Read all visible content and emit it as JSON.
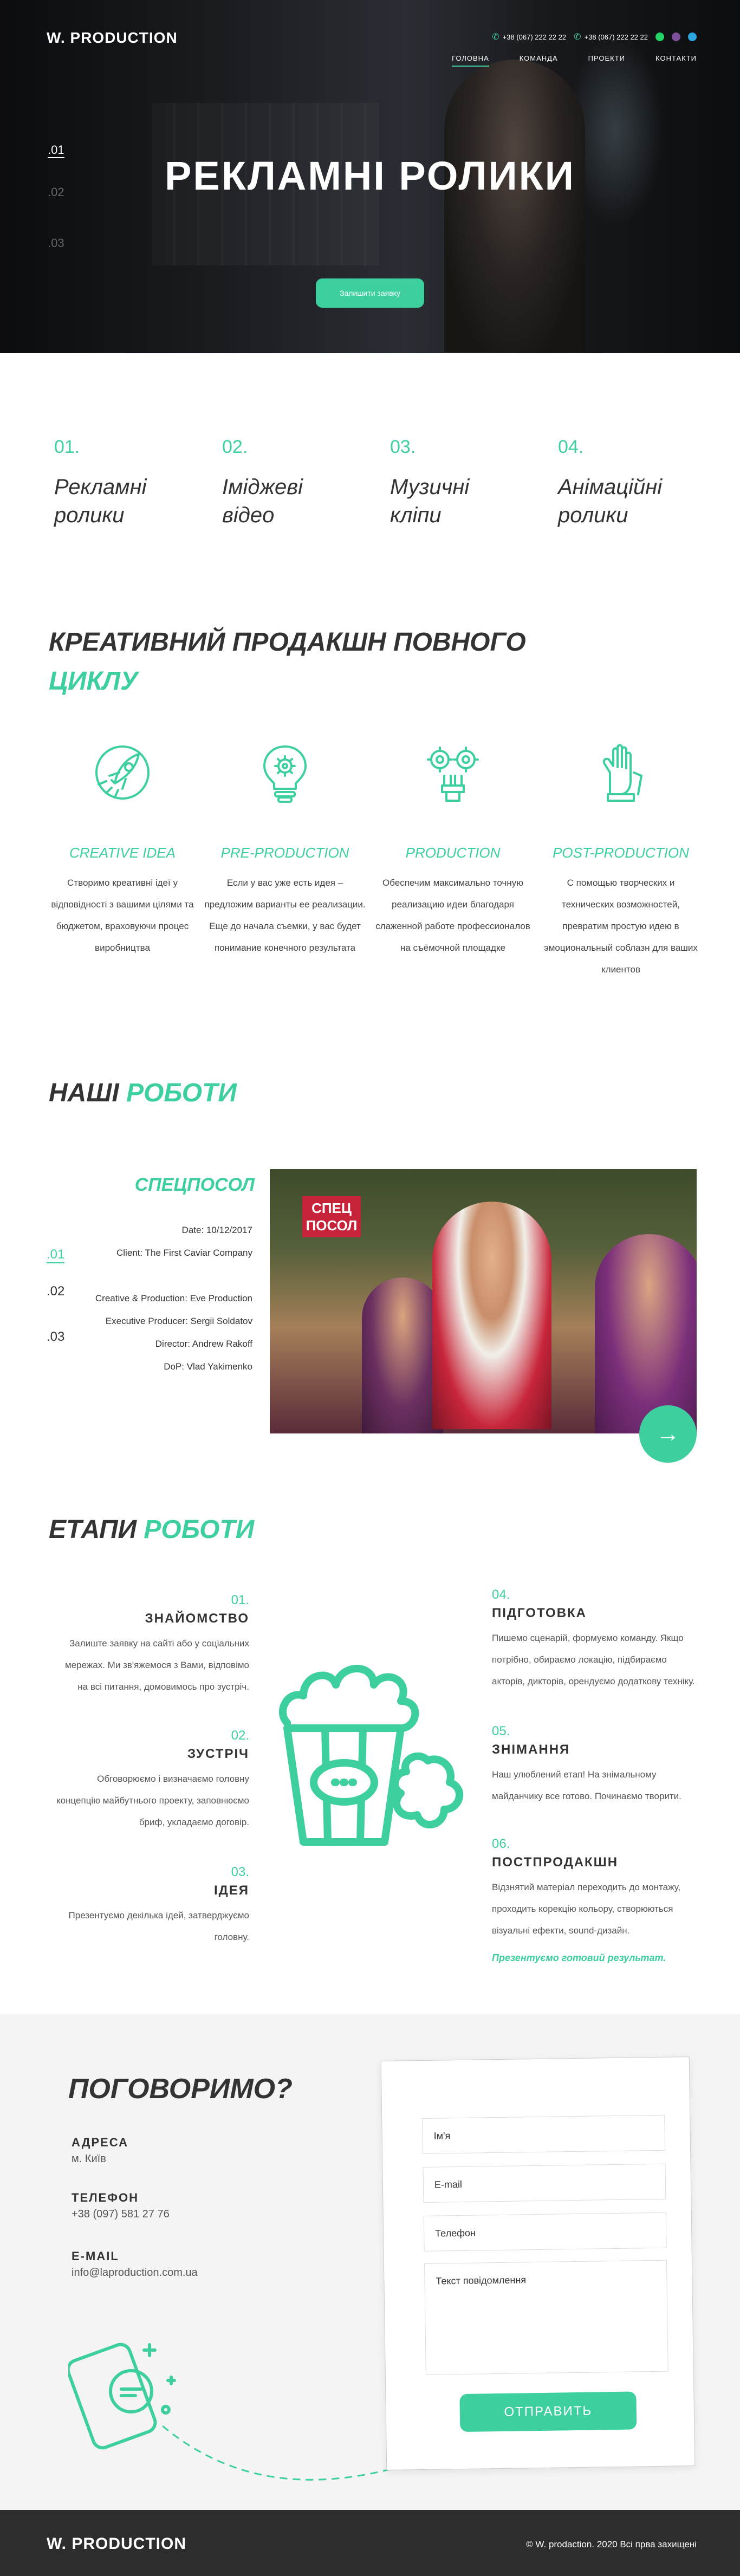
{
  "header": {
    "logo": "W. PRODUCTION",
    "phone1": "+38 (067) 222 22 22",
    "phone2": "+38 (067) 222 22 22",
    "nav": [
      "ГОЛОВНА",
      "КОМАНДА",
      "ПРОЕКТИ",
      "КОНТАКТИ"
    ]
  },
  "hero": {
    "slides": [
      ".01",
      ".02",
      ".03"
    ],
    "title": "РЕКЛАМНІ РОЛИКИ",
    "button": "Залишити заявку"
  },
  "services": [
    {
      "num": "01.",
      "title_1": "Рекламні",
      "title_2": "ролики"
    },
    {
      "num": "02.",
      "title_1": "Іміджеві",
      "title_2": "відео"
    },
    {
      "num": "03.",
      "title_1": "Музичні",
      "title_2": "кліпи"
    },
    {
      "num": "04.",
      "title_1": "Анімаційні",
      "title_2": "ролики"
    }
  ],
  "creative": {
    "heading_1": "КРЕАТИВНИЙ ПРОДАКШН ПОВНОГО",
    "heading_2": "ЦИКЛУ",
    "steps": [
      {
        "title": "CREATIVE IDEA",
        "lines": [
          "Створимо креативні ідеї у",
          "відповідності з вашими цілями та",
          "бюджетом, враховуючи процес",
          "виробництва"
        ]
      },
      {
        "title": "PRE-PRODUCTION",
        "lines": [
          "Если у вас уже есть идея –",
          "предложим варианты ее реализации.",
          "Еще до начала съемки, у вас будет",
          "понимание конечного результата"
        ]
      },
      {
        "title": "PRODUCTION",
        "lines": [
          "Обеспечим максимально точную",
          "реализацию идеи благодаря",
          "слаженной работе профессионалов",
          "на съёмочной площадке"
        ]
      },
      {
        "title": "POST-PRODUCTION",
        "lines": [
          "С помощью творческих и",
          "технических возможностей,",
          "превратим простую идею в",
          "эмоциональный соблазн для ваших",
          "клиентов"
        ]
      }
    ]
  },
  "works": {
    "heading_1": "НАШІ",
    "heading_2": "РОБОТИ",
    "project_title": "СПЕЦПОСОЛ",
    "meta": [
      "Date: 10/12/2017",
      "Client: The First Caviar Company",
      "",
      "Creative & Production: Eve Production",
      "Executive Producer: Sergii Soldatov",
      "Director: Andrew Rakoff",
      "DoP: Vlad Yakimenko"
    ],
    "slides": [
      ".01",
      ".02",
      ".03"
    ],
    "logo_text_1": "СПЕЦ",
    "logo_text_2": "ПОСОЛ"
  },
  "stages": {
    "heading_1": "ЕТАПИ",
    "heading_2": "РОБОТИ",
    "left": [
      {
        "num": "01.",
        "title": "ЗНАЙОМСТВО",
        "lines": [
          "Залиште заявку на сайті або у соціальних",
          "мережах. Ми зв'яжемося з Вами, відповімо",
          "на всі питання, домовимось про зустріч."
        ]
      },
      {
        "num": "02.",
        "title": "ЗУСТРІЧ",
        "lines": [
          "Обговорюємо і визначаємо головну",
          "концепцію майбутнього проекту, заповнюємо",
          "бриф, укладаємо договір."
        ]
      },
      {
        "num": "03.",
        "title": "ІДЕЯ",
        "lines": [
          "Презентуємо декілька ідей, затверджуємо",
          "головну."
        ]
      }
    ],
    "right": [
      {
        "num": "04.",
        "title": "ПІДГОТОВКА",
        "lines": [
          "Пишемо сценарій, формуємо команду. Якщо",
          "потрібно, обираємо локацію, підбираємо",
          "акторів, дикторів, орендуємо додаткову техніку."
        ]
      },
      {
        "num": "05.",
        "title": "ЗНІМАННЯ",
        "lines": [
          "Наш улюблений етап! На знімальному",
          "майданчику все готово.  Починаємо творити."
        ]
      },
      {
        "num": "06.",
        "title": "ПОСТПРОДАКШН",
        "lines": [
          "Відзнятий матеріал переходить до монтажу,",
          "проходить корекцію кольору, створюються",
          "візуальні ефекти, sound-дизайн."
        ]
      }
    ],
    "final": "Презентуємо готовий результат."
  },
  "contact": {
    "heading": "ПОГОВОРИМО?",
    "address_label": "АДРЕСА",
    "address": "м. Київ",
    "phone_label": "ТЕЛЕФОН",
    "phone": "+38 (097) 581 27 76",
    "email_label": "E-MAIL",
    "email": "info@laproduction.com.ua",
    "form": {
      "name": "Ім'я",
      "email": "E-mail",
      "phone": "Телефон",
      "message": "Текст повідомлення",
      "submit": "ОТПРАВИТЬ"
    }
  },
  "footer": {
    "logo": "W. PRODUCTION",
    "copy": "© W. prodaction. 2020 Всі прва захищені"
  },
  "colors": {
    "accent": "#3ecf9f",
    "dark": "#2d2d2d"
  }
}
